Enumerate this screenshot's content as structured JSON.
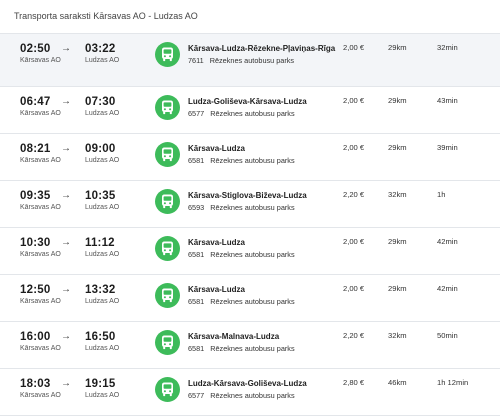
{
  "page": {
    "title": "Transporta saraksti Kārsavas AO - Ludzas AO"
  },
  "colors": {
    "bus_icon": "#3dbb5a",
    "row_highlight": "#f3f5f8",
    "divider": "#e3e6ea"
  },
  "icons": {
    "arrow": "→",
    "bus": "bus-icon"
  },
  "trips": [
    {
      "dep_time": "02:50",
      "dep_stop": "Kārsavas AO",
      "arr_time": "03:22",
      "arr_stop": "Ludzas AO",
      "route": "Kārsava-Ludza-Rēzekne-Pļaviņas-Rīga",
      "route_no": "7611",
      "operator": "Rēzeknes autobusu parks",
      "price": "2,00 €",
      "distance": "29km",
      "duration": "32min"
    },
    {
      "dep_time": "06:47",
      "dep_stop": "Kārsavas AO",
      "arr_time": "07:30",
      "arr_stop": "Ludzas AO",
      "route": "Ludza-Goliševa-Kārsava-Ludza",
      "route_no": "6577",
      "operator": "Rēzeknes autobusu parks",
      "price": "2,00 €",
      "distance": "29km",
      "duration": "43min"
    },
    {
      "dep_time": "08:21",
      "dep_stop": "Kārsavas AO",
      "arr_time": "09:00",
      "arr_stop": "Ludzas AO",
      "route": "Kārsava-Ludza",
      "route_no": "6581",
      "operator": "Rēzeknes autobusu parks",
      "price": "2,00 €",
      "distance": "29km",
      "duration": "39min"
    },
    {
      "dep_time": "09:35",
      "dep_stop": "Kārsavas AO",
      "arr_time": "10:35",
      "arr_stop": "Ludzas AO",
      "route": "Kārsava-Stiglova-Biževa-Ludza",
      "route_no": "6593",
      "operator": "Rēzeknes autobusu parks",
      "price": "2,20 €",
      "distance": "32km",
      "duration": "1h"
    },
    {
      "dep_time": "10:30",
      "dep_stop": "Kārsavas AO",
      "arr_time": "11:12",
      "arr_stop": "Ludzas AO",
      "route": "Kārsava-Ludza",
      "route_no": "6581",
      "operator": "Rēzeknes autobusu parks",
      "price": "2,00 €",
      "distance": "29km",
      "duration": "42min"
    },
    {
      "dep_time": "12:50",
      "dep_stop": "Kārsavas AO",
      "arr_time": "13:32",
      "arr_stop": "Ludzas AO",
      "route": "Kārsava-Ludza",
      "route_no": "6581",
      "operator": "Rēzeknes autobusu parks",
      "price": "2,00 €",
      "distance": "29km",
      "duration": "42min"
    },
    {
      "dep_time": "16:00",
      "dep_stop": "Kārsavas AO",
      "arr_time": "16:50",
      "arr_stop": "Ludzas AO",
      "route": "Kārsava-Malnava-Ludza",
      "route_no": "6581",
      "operator": "Rēzeknes autobusu parks",
      "price": "2,20 €",
      "distance": "32km",
      "duration": "50min"
    },
    {
      "dep_time": "18:03",
      "dep_stop": "Kārsavas AO",
      "arr_time": "19:15",
      "arr_stop": "Ludzas AO",
      "route": "Ludza-Kārsava-Goliševa-Ludza",
      "route_no": "6577",
      "operator": "Rēzeknes autobusu parks",
      "price": "2,80 €",
      "distance": "46km",
      "duration": "1h 12min"
    }
  ]
}
